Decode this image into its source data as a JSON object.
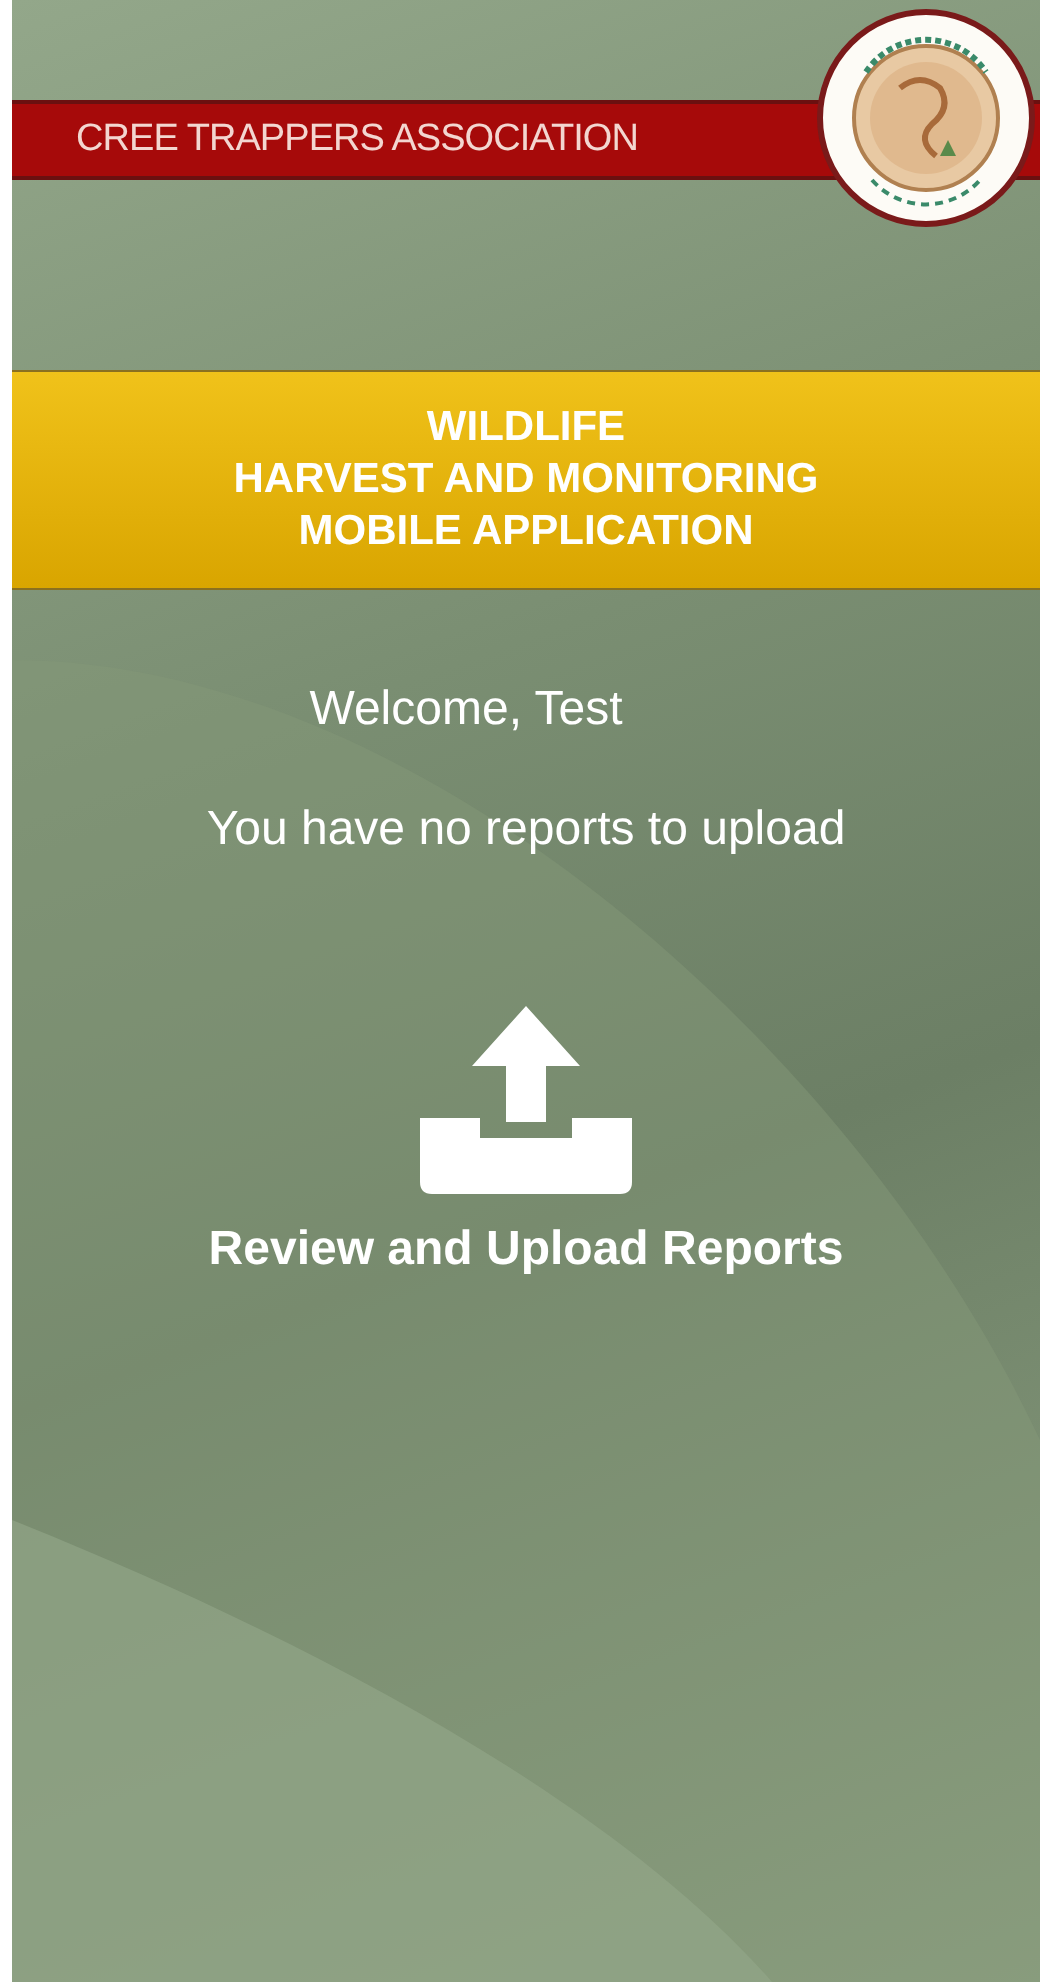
{
  "header": {
    "organization": "CREE TRAPPERS ASSOCIATION"
  },
  "banner": {
    "lines": [
      "WILDLIFE",
      "HARVEST AND MONITORING",
      "MOBILE APPLICATION"
    ]
  },
  "greeting": "Welcome, Test",
  "status": "You have no reports to upload",
  "upload_button": {
    "label": "Review and Upload Reports"
  }
}
